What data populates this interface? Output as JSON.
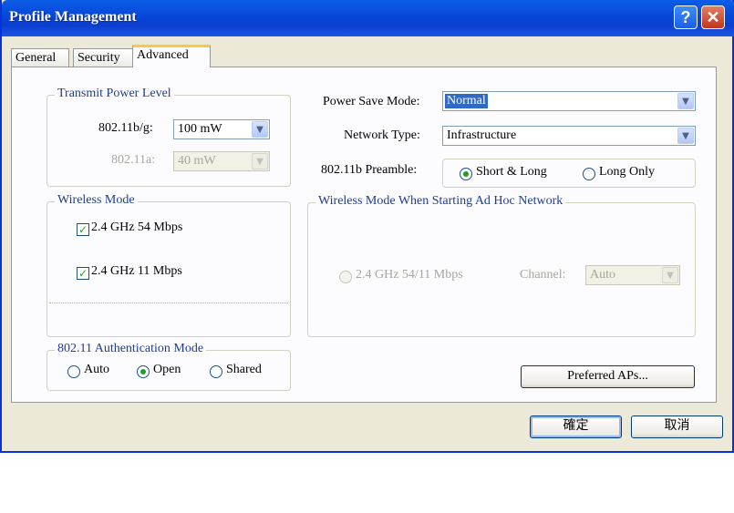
{
  "window": {
    "title": "Profile Management"
  },
  "titlebar": {
    "help_glyph": "?",
    "close_glyph": "✕"
  },
  "tabs": [
    {
      "label": "General",
      "active": false
    },
    {
      "label": "Security",
      "active": false
    },
    {
      "label": "Advanced",
      "active": true
    }
  ],
  "transmit_power": {
    "legend": "Transmit Power Level",
    "bg_label": "802.11b/g:",
    "bg_value": "100 mW",
    "a_label": "802.11a:",
    "a_value": "40 mW"
  },
  "wireless_mode": {
    "legend": "Wireless Mode",
    "options": [
      {
        "label": "2.4 GHz 54 Mbps",
        "checked": true
      },
      {
        "label": "2.4 GHz 11 Mbps",
        "checked": true
      }
    ],
    "check_glyph": "✓"
  },
  "auth_mode": {
    "legend": "802.11 Authentication Mode",
    "options": [
      "Auto",
      "Open",
      "Shared"
    ],
    "selected": "Open"
  },
  "power_save": {
    "label": "Power Save Mode:",
    "value": "Normal"
  },
  "network_type": {
    "label": "Network Type:",
    "value": "Infrastructure"
  },
  "preamble": {
    "label": "802.11b Preamble:",
    "options": [
      "Short & Long",
      "Long Only"
    ],
    "selected": "Short & Long"
  },
  "adhoc": {
    "legend": "Wireless Mode When Starting Ad Hoc Network",
    "radio_label": "2.4 GHz 54/11 Mbps",
    "channel_label": "Channel:",
    "channel_value": "Auto"
  },
  "preferred_aps_button": "Preferred APs...",
  "footer": {
    "ok_label": "確定",
    "cancel_label": "取消"
  },
  "combo_arrow_glyph": "▼"
}
